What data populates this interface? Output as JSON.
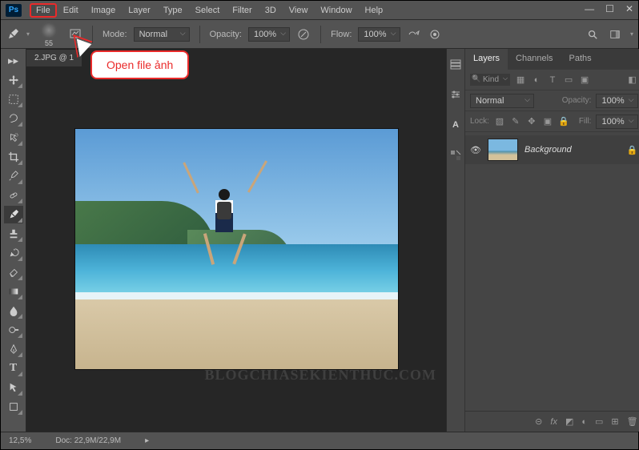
{
  "app": {
    "logo": "Ps"
  },
  "menubar": {
    "items": [
      "File",
      "Edit",
      "Image",
      "Layer",
      "Type",
      "Select",
      "Filter",
      "3D",
      "View",
      "Window",
      "Help"
    ],
    "highlighted_index": 0
  },
  "callout": {
    "text": "Open file ảnh"
  },
  "options_bar": {
    "brush_size": "55",
    "mode_label": "Mode:",
    "mode_value": "Normal",
    "opacity_label": "Opacity:",
    "opacity_value": "100%",
    "flow_label": "Flow:",
    "flow_value": "100%"
  },
  "document": {
    "tab_title": "2.JPG @ 1",
    "watermark": "BLOGCHIASEKIENTHUC.COM"
  },
  "status": {
    "zoom": "12,5%",
    "doc_label": "Doc:",
    "doc_size": "22,9M/22,9M"
  },
  "panels": {
    "tabs": [
      "Layers",
      "Channels",
      "Paths"
    ],
    "active_tab": 0,
    "filter": {
      "kind": "Kind"
    },
    "blend": {
      "mode": "Normal",
      "opacity_label": "Opacity:",
      "opacity_value": "100%"
    },
    "lock": {
      "label": "Lock:",
      "fill_label": "Fill:",
      "fill_value": "100%"
    },
    "layers": [
      {
        "name": "Background",
        "visible": true,
        "locked": true
      }
    ],
    "footer_icons": [
      "⊕",
      "fx",
      "◐",
      "◑",
      "▭",
      "⊞",
      "🗑"
    ]
  }
}
